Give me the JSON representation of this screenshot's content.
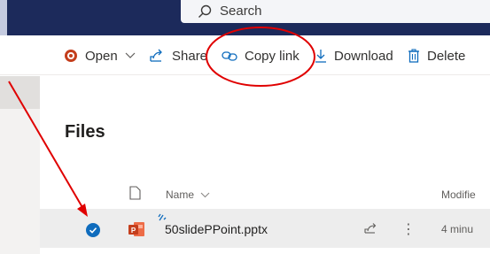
{
  "search": {
    "placeholder": "Search"
  },
  "commands": {
    "open": "Open",
    "share": "Share",
    "copy_link": "Copy link",
    "download": "Download",
    "delete": "Delete"
  },
  "page": {
    "title": "Files"
  },
  "table": {
    "columns": {
      "name": "Name",
      "modified": "Modifie"
    },
    "rows": [
      {
        "name": "50slidePPoint.pptx",
        "modified": "4 minu",
        "selected": true
      }
    ]
  },
  "colors": {
    "topbar": "#1c2a5b",
    "accent": "#0f6cbd",
    "annotation": "#e00000",
    "powerpoint": "#c43e1c"
  },
  "icons": {
    "search": "search-icon",
    "open": "powerpoint-icon",
    "share": "share-icon",
    "copy_link": "link-icon",
    "download": "download-icon",
    "delete": "trash-icon",
    "file_type": "document-icon",
    "selected": "checkmark-icon",
    "new_file": "sparkle-icon",
    "more": "more-icon"
  }
}
